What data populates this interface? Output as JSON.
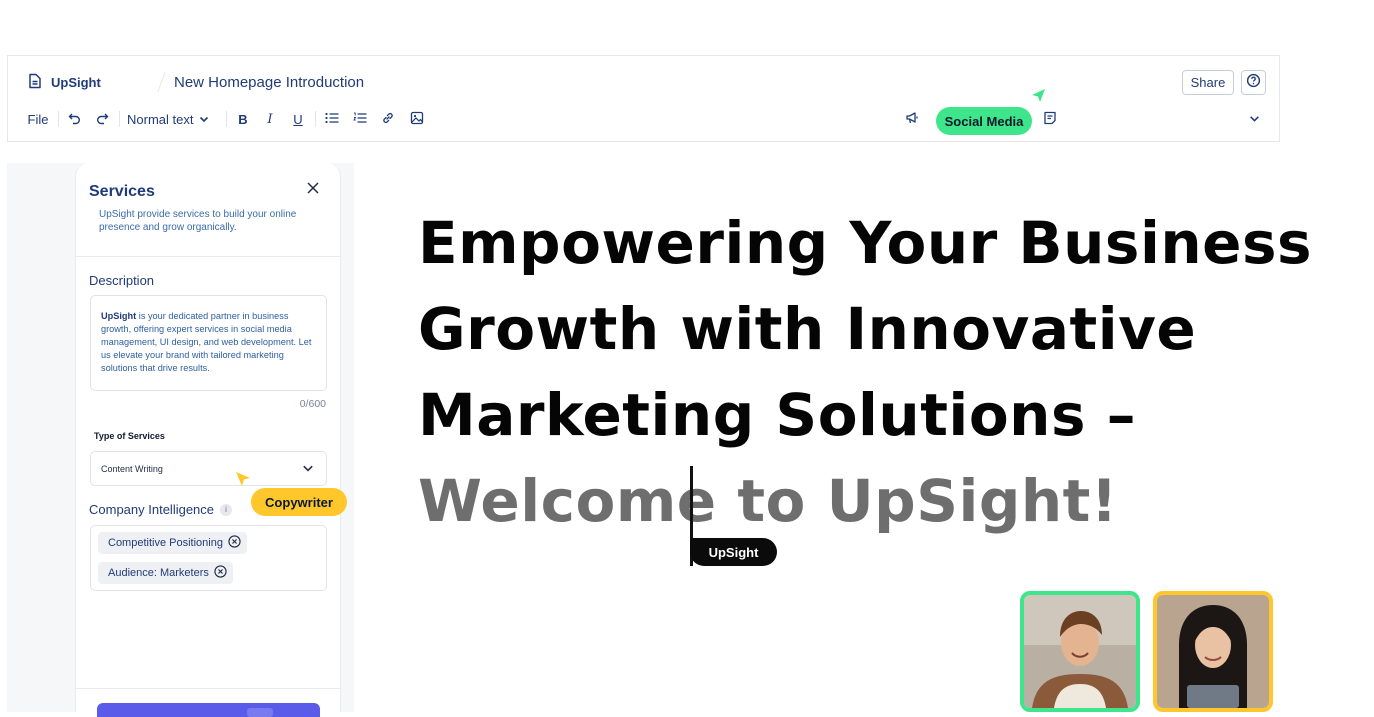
{
  "header": {
    "brand": "UpSight",
    "doc_title": "New Homepage Introduction",
    "share_label": "Share"
  },
  "toolbar": {
    "file_label": "File",
    "style_label": "Normal text",
    "bold_label": "B",
    "italic_label": "I",
    "underline_label": "U",
    "social_media_label": "Social Media"
  },
  "panel": {
    "title": "Services",
    "subtitle": "UpSight provide services to build your online presence and grow organically.",
    "description_label": "Description",
    "description_bold": "UpSight",
    "description_text": " is your dedicated partner in business growth, offering expert services in social media management, UI design, and web development. Let us elevate your brand with tailored marketing solutions that drive results.",
    "char_count": "0/600",
    "type_label": "Type of Services",
    "type_value": "Content Writing",
    "copywriter_label": "Copywriter",
    "ci_label": "Company Intelligence",
    "tags": [
      {
        "label": "Competitive Positioning"
      },
      {
        "label": "Audience: Marketers"
      }
    ]
  },
  "document": {
    "line1": "Empowering Your Business",
    "line2": "Growth with Innovative",
    "line3": "Marketing Solutions –",
    "line4": "Welcome to UpSight!",
    "cursor_label": "UpSight"
  },
  "colors": {
    "brand_navy": "#1f3b78",
    "social_green": "#3ee58a",
    "copywriter_yellow": "#ffc72c",
    "primary_button": "#5b5bea"
  }
}
